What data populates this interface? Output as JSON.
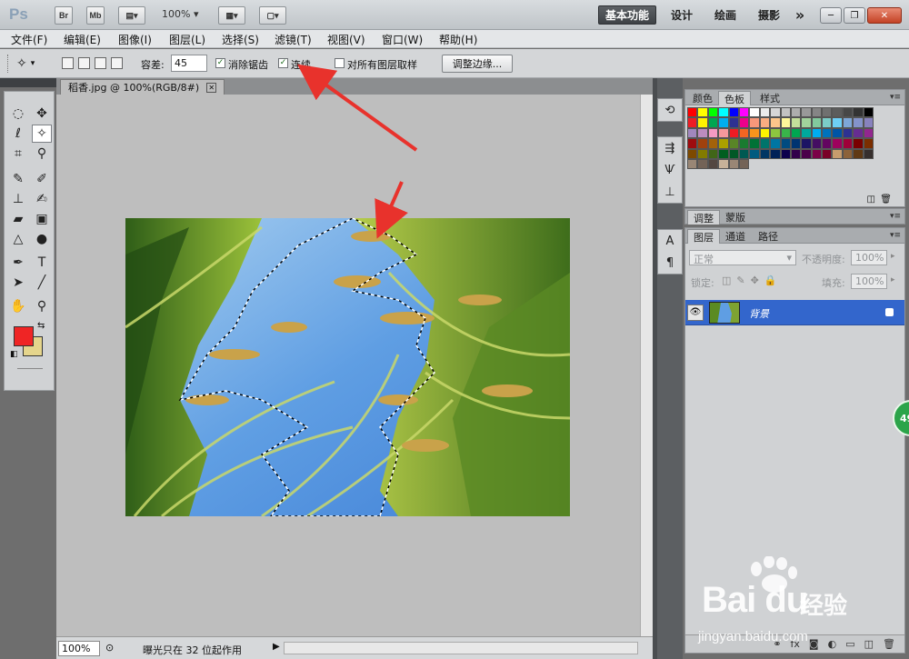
{
  "titlebar": {
    "logo": "Ps",
    "bridge_label": "Br",
    "minibridge_label": "Mb",
    "zoom_value": "100%",
    "workspaces": [
      "基本功能",
      "设计",
      "绘画",
      "摄影"
    ],
    "more_label": "»",
    "win_min": "─",
    "win_restore": "❐",
    "win_close": "✕"
  },
  "menu": [
    "文件(F)",
    "编辑(E)",
    "图像(I)",
    "图层(L)",
    "选择(S)",
    "滤镜(T)",
    "视图(V)",
    "窗口(W)",
    "帮助(H)"
  ],
  "options": {
    "tolerance_label": "容差:",
    "tolerance_value": "45",
    "antialias_label": "消除锯齿",
    "antialias_checked": true,
    "contiguous_label": "连续",
    "contiguous_checked": true,
    "sample_all_label": "对所有图层取样",
    "sample_all_checked": false,
    "refine_edge_label": "调整边缘..."
  },
  "document": {
    "tab_title": "稻香.jpg @ 100%(RGB/8#)",
    "close_glyph": "✕",
    "status_zoom": "100%",
    "status_text": "曝光只在 32 位起作用"
  },
  "panels": {
    "swatches_tabs": [
      "颜色",
      "色板",
      "样式"
    ],
    "adjust_tabs": [
      "调整",
      "蒙版"
    ],
    "layers_tabs": [
      "图层",
      "通道",
      "路径"
    ],
    "blend_mode": "正常",
    "opacity_label": "不透明度:",
    "opacity_value": "100%",
    "lock_label": "锁定:",
    "fill_label": "填充:",
    "fill_value": "100%",
    "layer_name": "背景"
  },
  "swatch_colors": [
    "#ff0000",
    "#ffff00",
    "#00ff00",
    "#00ffff",
    "#0000ff",
    "#ff00ff",
    "#ffffff",
    "#ebebeb",
    "#d6d6d6",
    "#c2c2c2",
    "#adadad",
    "#999999",
    "#858585",
    "#707070",
    "#5c5c5c",
    "#474747",
    "#333333",
    "#000000",
    "#ee1d24",
    "#fff200",
    "#00a651",
    "#00aeef",
    "#2e3192",
    "#ec008c",
    "#f7977a",
    "#f9ad81",
    "#fdc68a",
    "#fff79a",
    "#c4df9b",
    "#a2d39c",
    "#82ca9d",
    "#7bcdc8",
    "#6ecff6",
    "#7ea7d8",
    "#8493ca",
    "#8882be",
    "#a187be",
    "#bc8cbf",
    "#f49ac2",
    "#f6989d",
    "#ed1c24",
    "#f26522",
    "#f7941d",
    "#fff200",
    "#8dc73f",
    "#39b54a",
    "#00a651",
    "#00a99d",
    "#00aeef",
    "#0072bc",
    "#0054a6",
    "#2e3192",
    "#662d91",
    "#92278f",
    "#9e0b0f",
    "#a0410d",
    "#a3620a",
    "#aba000",
    "#598527",
    "#1a7b30",
    "#007236",
    "#00746b",
    "#0076a3",
    "#004b80",
    "#003471",
    "#1b1464",
    "#440e62",
    "#630460",
    "#9e005d",
    "#9e0039",
    "#790000",
    "#7b2e00",
    "#7d4900",
    "#827b00",
    "#406618",
    "#005e20",
    "#005826",
    "#005952",
    "#005b7f",
    "#003663",
    "#002157",
    "#0d004c",
    "#32004b",
    "#4b0049",
    "#7b0046",
    "#7a0026",
    "#c69c6d",
    "#8c6239",
    "#603913",
    "#362f2d",
    "#998675",
    "#736357",
    "#534741",
    "#c7b299",
    "#998675",
    "#736357"
  ]
}
